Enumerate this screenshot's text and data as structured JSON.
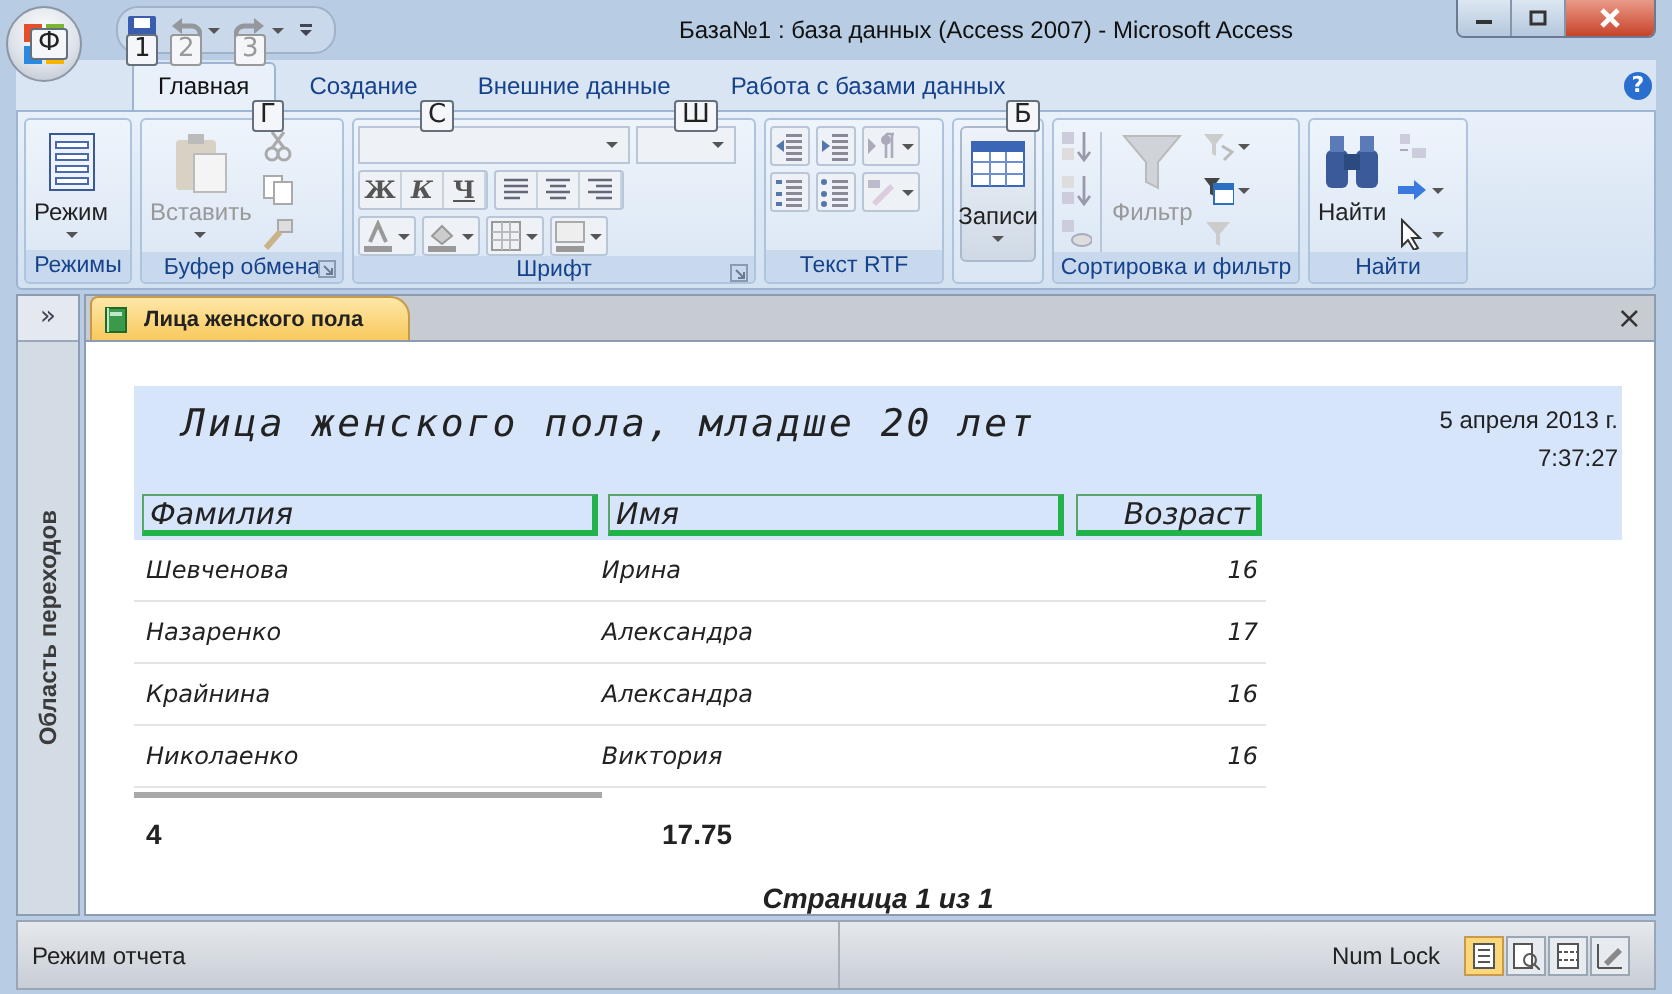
{
  "window": {
    "title": "База№1 : база данных (Access 2007) - Microsoft Access",
    "help_glyph": "?"
  },
  "office_button": {
    "keytip": "Ф"
  },
  "quick_access": [
    {
      "keytip": "1",
      "disabled": false
    },
    {
      "keytip": "2",
      "disabled": true
    },
    {
      "keytip": "3",
      "disabled": true
    }
  ],
  "ribbon_tabs": [
    {
      "label": "Главная",
      "selected": true,
      "keytip": "Г"
    },
    {
      "label": "Создание",
      "selected": false,
      "keytip": "С"
    },
    {
      "label": "Внешние данные",
      "selected": false,
      "keytip": "Ш"
    },
    {
      "label": "Работа с базами данных",
      "selected": false,
      "keytip": "Б"
    }
  ],
  "ribbon_groups": [
    {
      "kind": "views",
      "title": "Режимы",
      "large": {
        "label": "Режим",
        "disabled": false,
        "dropdown": true
      }
    },
    {
      "kind": "clipboard",
      "title": "Буфер обмена",
      "launcher": true,
      "large": {
        "label": "Вставить",
        "disabled": true,
        "dropdown": true
      }
    },
    {
      "kind": "font",
      "title": "Шрифт",
      "launcher": true,
      "styles": [
        "Ж",
        "К",
        "Ч"
      ]
    },
    {
      "kind": "rtf",
      "title": "Текст RTF"
    },
    {
      "kind": "records",
      "large": {
        "label": "Записи",
        "disabled": false,
        "dropdown": true
      }
    },
    {
      "kind": "sort",
      "title": "Сортировка и фильтр",
      "large": {
        "label": "Фильтр",
        "disabled": true,
        "dropdown": false
      }
    },
    {
      "kind": "find",
      "title": "Найти",
      "large": {
        "label": "Найти",
        "disabled": false,
        "dropdown": false
      }
    }
  ],
  "nav_pane": {
    "expand_glyph": "»",
    "label": "Область переходов"
  },
  "doc_tab": {
    "label": "Лица женского пола",
    "selected": true,
    "close_glyph": "×"
  },
  "report": {
    "title": "Лица женского пола, младше 20 лет",
    "date": "5 апреля 2013 г.",
    "time": "7:37:27",
    "columns": [
      "Фамилия",
      "Имя",
      "Возраст"
    ],
    "rows": [
      [
        "Шевченова",
        "Ирина",
        "16"
      ],
      [
        "Назаренко",
        "Александра",
        "17"
      ],
      [
        "Крайнина",
        "Александра",
        "16"
      ],
      [
        "Николаенко",
        "Виктория",
        "16"
      ]
    ],
    "count": "4",
    "average": "17.75",
    "page": "Страница 1 из 1"
  },
  "status_bar": {
    "mode": "Режим отчета",
    "indicator": "Num Lock",
    "views": [
      {
        "selected": true
      },
      {
        "selected": false
      },
      {
        "selected": false
      },
      {
        "selected": false
      }
    ]
  }
}
